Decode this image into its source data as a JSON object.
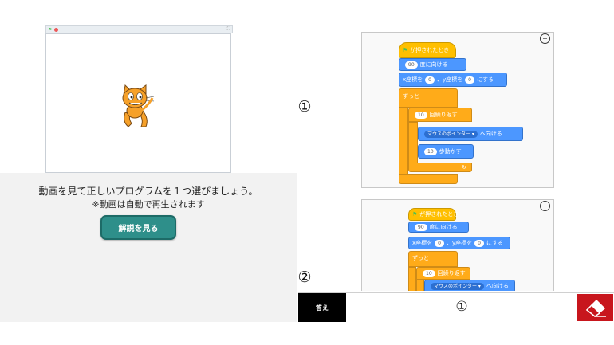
{
  "stage": {
    "sprite_icon": "scratch-cat-icon",
    "flag_icon": "green-flag-icon",
    "stop_icon": "stop-icon",
    "fullscreen_icon": "fullscreen-icon"
  },
  "instructions": {
    "line1": "動画を見て正しいプログラムを１つ選びましょう。",
    "line2": "※動画は自動で再生されます"
  },
  "explain_button": {
    "label": "解説を見る"
  },
  "choices": [
    {
      "number": "①",
      "zoom_icon": "zoom-in-icon",
      "blocks": {
        "when_flag": "が押されたとき",
        "point_dir_value": "90",
        "point_dir_text": "度に向ける",
        "goto_x_label": "x座標を",
        "goto_x_value": "0",
        "goto_y_label": "、y座標を",
        "goto_y_value": "0",
        "goto_suffix": "にする",
        "forever": "ずっと",
        "repeat_value": "10",
        "repeat_text": "回繰り返す",
        "point_towards_value": "マウスのポインター ▾",
        "point_towards_text": "へ向ける",
        "move_value": "10",
        "move_text": "歩動かす",
        "loop_arrow": "↻"
      }
    },
    {
      "number": "②",
      "zoom_icon": "zoom-in-icon",
      "blocks": {
        "when_flag": "が押されたとき",
        "point_dir_value": "90",
        "point_dir_text": "度に向ける",
        "goto_x_label": "x座標を",
        "goto_x_value": "0",
        "goto_y_label": "、y座標を",
        "goto_y_value": "0",
        "goto_suffix": "にする",
        "forever": "ずっと",
        "repeat_value": "10",
        "repeat_text": "回繰り返す",
        "point_towards_value": "マウスのポインター ▾",
        "point_towards_text": "へ向ける"
      }
    }
  ],
  "answer": {
    "label": "答え",
    "value": "①",
    "eraser_icon": "eraser-icon"
  },
  "colors": {
    "explain_button": "#2e8f8a",
    "answer_label_bg": "#000000",
    "eraser_bg": "#c8161d",
    "events_block": "#ffbf00",
    "motion_block": "#4c97ff",
    "control_block": "#ffab19"
  }
}
